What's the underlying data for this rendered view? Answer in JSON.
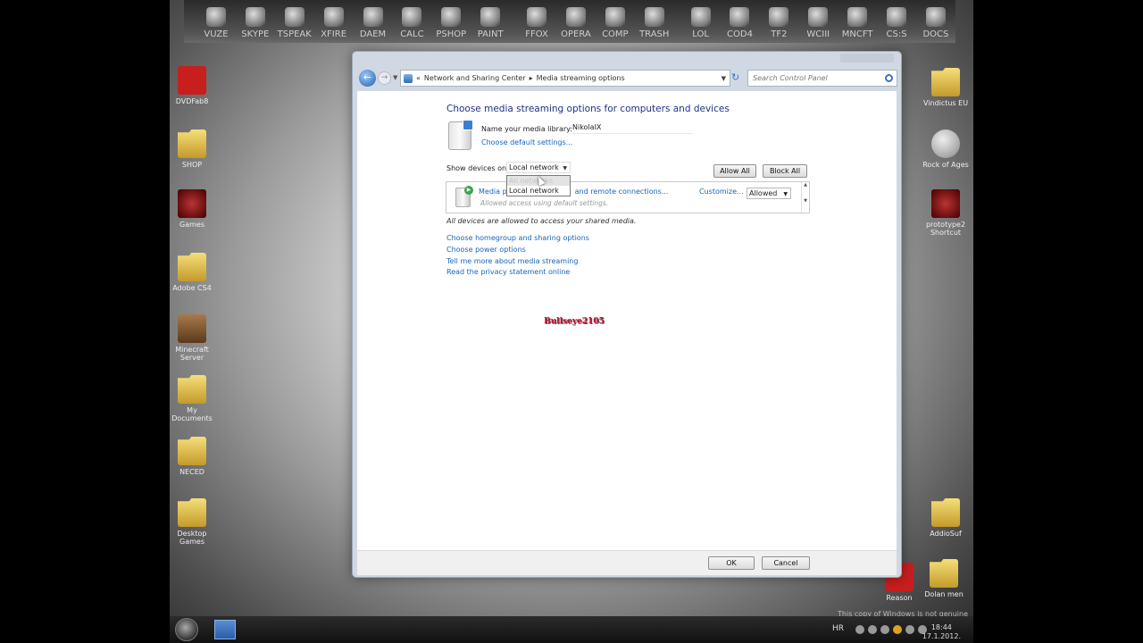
{
  "dock": {
    "items": [
      {
        "label": "VUZE",
        "icon": "vuze-icon"
      },
      {
        "label": "SKYPE",
        "icon": "skype-icon"
      },
      {
        "label": "TSPEAK",
        "icon": "teamspeak-icon"
      },
      {
        "label": "XFIRE",
        "icon": "xfire-icon"
      },
      {
        "label": "DAEM",
        "icon": "daemon-tools-icon"
      },
      {
        "label": "CALC",
        "icon": "calculator-icon"
      },
      {
        "label": "PSHOP",
        "icon": "photoshop-icon"
      },
      {
        "label": "PAINT",
        "icon": "paint-icon"
      },
      {
        "label": "FFOX",
        "icon": "firefox-icon"
      },
      {
        "label": "OPERA",
        "icon": "opera-icon"
      },
      {
        "label": "COMP",
        "icon": "computer-icon"
      },
      {
        "label": "TRASH",
        "icon": "trash-icon"
      },
      {
        "label": "LOL",
        "icon": "lol-icon"
      },
      {
        "label": "COD4",
        "icon": "cod4-icon"
      },
      {
        "label": "TF2",
        "icon": "tf2-icon"
      },
      {
        "label": "WCIII",
        "icon": "warcraft-icon"
      },
      {
        "label": "MNCFT",
        "icon": "minecraft-icon"
      },
      {
        "label": "CS:S",
        "icon": "counter-strike-icon"
      },
      {
        "label": "DOCS",
        "icon": "documents-icon"
      }
    ]
  },
  "desktop": {
    "left_icons": [
      {
        "label": "DVDFab8"
      },
      {
        "label": "SHOP"
      },
      {
        "label": "Games"
      },
      {
        "label": "Adobe CS4"
      },
      {
        "label": "Minecraft Server"
      },
      {
        "label": "My Documents"
      },
      {
        "label": "NECED"
      },
      {
        "label": "Desktop Games"
      }
    ],
    "right_icons": [
      {
        "label": "Vindictus EU"
      },
      {
        "label": "Rock of Ages"
      },
      {
        "label": "prototype2 Shortcut"
      },
      {
        "label": "AddioSuf"
      },
      {
        "label": "Reason"
      },
      {
        "label": "Dolan men"
      }
    ]
  },
  "window": {
    "breadcrumb": [
      "Network and Sharing Center",
      "Media streaming options"
    ],
    "search_placeholder": "Search Control Panel",
    "heading": "Choose media streaming options for computers and devices",
    "library_label": "Name your media library:",
    "library_value": "NikolaIX",
    "default_settings_link": "Choose default settings...",
    "show_devices_label": "Show devices on:",
    "show_devices_value": "Local network",
    "dropdown_options": [
      "All networks",
      "Local network"
    ],
    "allow_all": "Allow All",
    "block_all": "Block All",
    "device": {
      "name": "Media p",
      "name_tail": "and remote connections...",
      "status": "Allowed access using default settings.",
      "customize": "Customize...",
      "access": "Allowed"
    },
    "note": "All devices are allowed to access your shared media.",
    "links": [
      "Choose homegroup and sharing options",
      "Choose power options",
      "Tell me more about media streaming",
      "Read the privacy statement online"
    ],
    "credit": "Bullseye2105",
    "ok": "OK",
    "cancel": "Cancel"
  },
  "taskbar": {
    "lang": "HR",
    "time": "18:44",
    "date": "17.1.2012.",
    "watermark": "This copy of Windows is not genuine"
  }
}
